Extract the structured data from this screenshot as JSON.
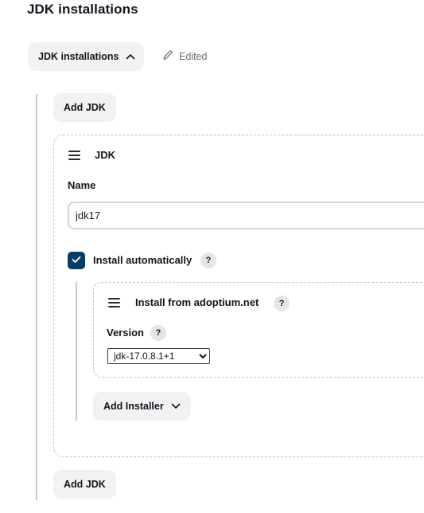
{
  "section": {
    "title": "JDK installations"
  },
  "toggle": {
    "label": "JDK installations",
    "icon": "chevron-up-icon"
  },
  "status": {
    "edited_label": "Edited",
    "icon": "pencil-icon"
  },
  "buttons": {
    "add_jdk_top": "Add JDK",
    "add_jdk_bottom": "Add JDK"
  },
  "jdk_item": {
    "heading": "JDK",
    "name_label": "Name",
    "name_value": "jdk17",
    "install_automatically": {
      "label": "Install automatically",
      "checked": true,
      "help": "?"
    },
    "installer": {
      "heading": "Install from adoptium.net",
      "help": "?",
      "version_label": "Version",
      "version_help": "?",
      "version_selected": "jdk-17.0.8.1+1"
    },
    "add_installer_label": "Add Installer"
  },
  "colors": {
    "accent": "#0a3d66",
    "button_bg": "#f2f2f3",
    "border": "#c4c4ca"
  }
}
